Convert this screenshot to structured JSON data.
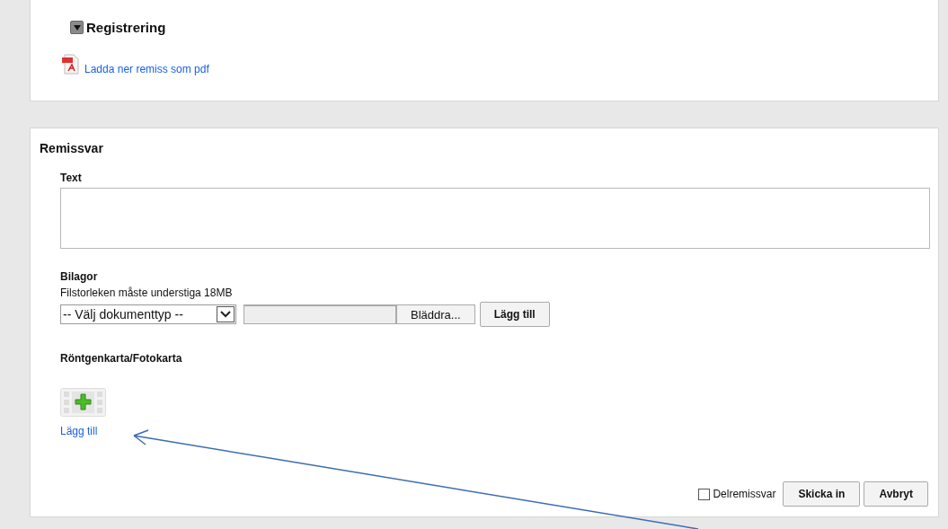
{
  "registration": {
    "title": "Registrering",
    "expanded": true,
    "download_link": "Ladda ner remiss som pdf"
  },
  "reply": {
    "title": "Remissvar",
    "text_label": "Text",
    "attachments": {
      "title": "Bilagor",
      "hint": "Filstorleken måste understiga 18MB",
      "doc_type": "-- Välj dokumenttyp --",
      "browse_button": "Bläddra...",
      "add_button": "Lägg till"
    },
    "xray": {
      "title": "Röntgenkarta/Fotokarta",
      "add_link": "Lägg till"
    },
    "partial": {
      "label": "Delremissvar",
      "checked": false
    },
    "buttons": [
      "Skicka in",
      "Avbryt"
    ]
  }
}
